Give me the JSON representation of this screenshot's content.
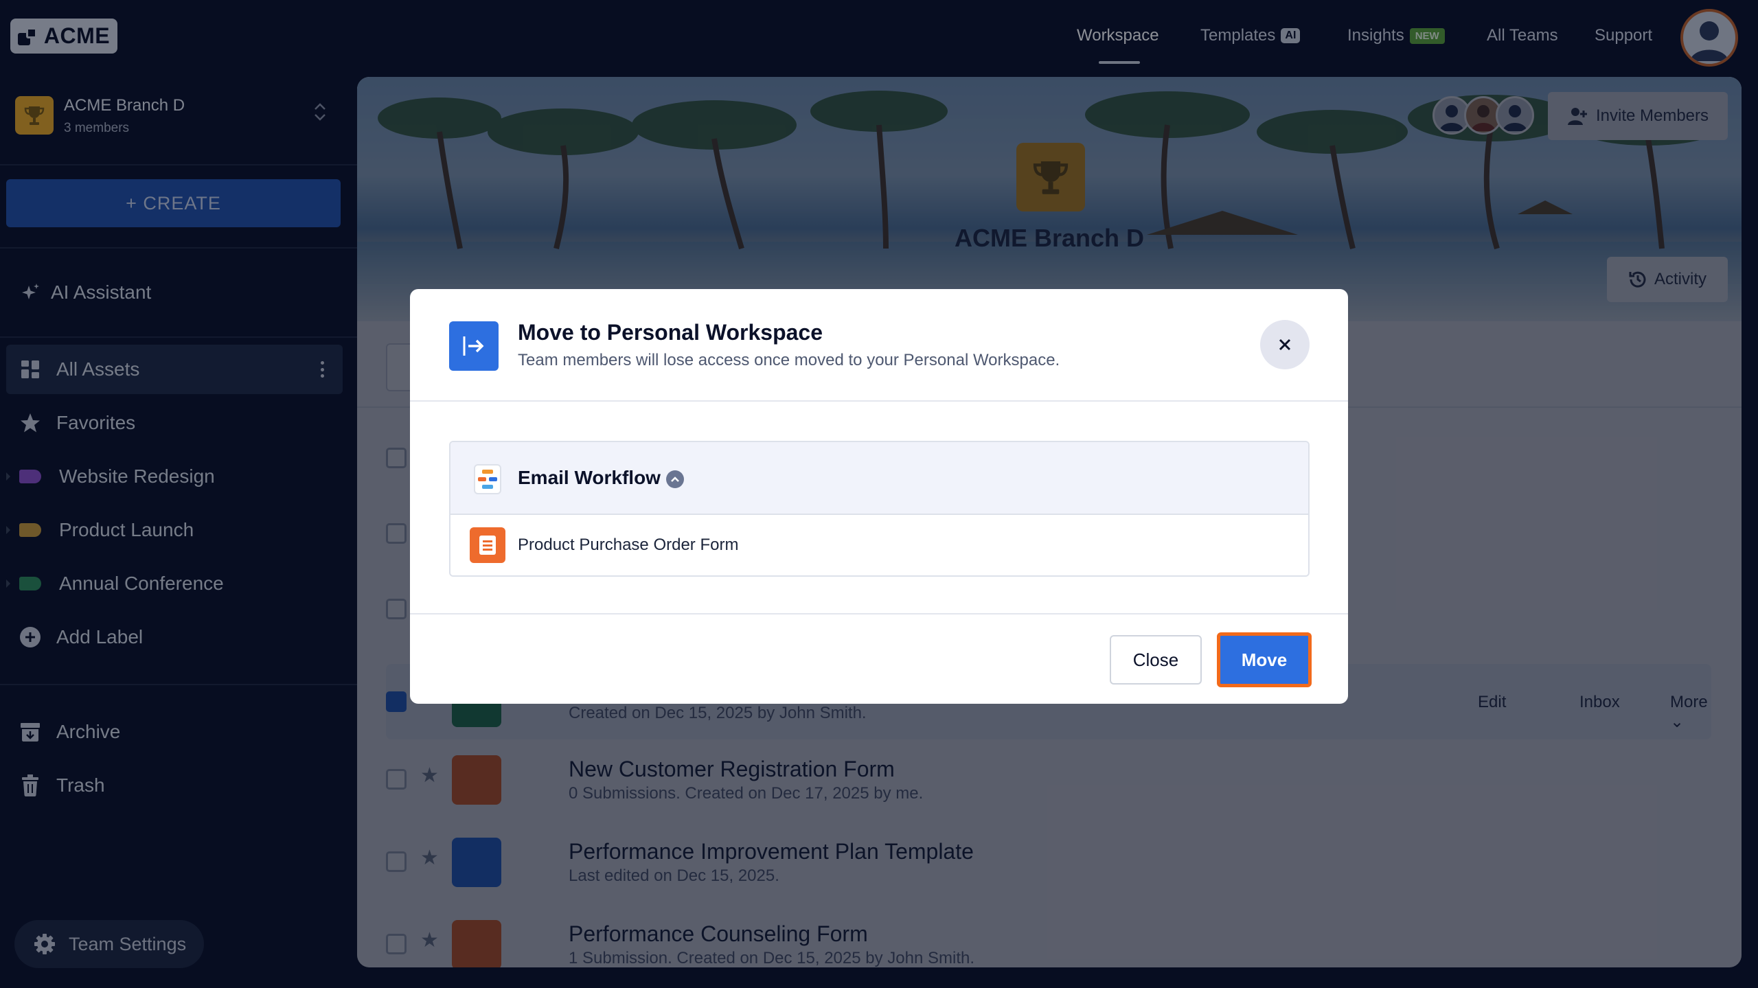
{
  "brand": {
    "logo_text": "ACME"
  },
  "nav": {
    "workspace": "Workspace",
    "templates": "Templates",
    "templates_badge": "AI",
    "insights": "Insights",
    "insights_badge": "NEW",
    "all_teams": "All Teams",
    "support": "Support"
  },
  "team": {
    "name": "ACME Branch D",
    "members": "3 members"
  },
  "sidebar": {
    "create_label": "+ CREATE",
    "ai_assistant": "AI Assistant",
    "all_assets": "All Assets",
    "favorites": "Favorites",
    "labels": [
      {
        "name": "Website Redesign",
        "color": "#8a4fc9"
      },
      {
        "name": "Product Launch",
        "color": "#c99a3a"
      },
      {
        "name": "Annual Conference",
        "color": "#2f8a5a"
      }
    ],
    "add_label": "Add Label",
    "archive": "Archive",
    "trash": "Trash",
    "team_settings": "Team Settings"
  },
  "banner": {
    "title": "ACME Branch D",
    "invite_label": "Invite Members",
    "activity_label": "Activity"
  },
  "assets": {
    "selected_row_sub": "Created on Dec 15, 2025 by John Smith.",
    "row_actions": {
      "edit": "Edit",
      "inbox": "Inbox",
      "more": "More"
    },
    "rows": [
      {
        "title": "New Customer Registration Form",
        "sub": "0 Submissions. Created on Dec 17, 2025 by me.",
        "icon_color": "#ee6b2d"
      },
      {
        "title": "Performance Improvement Plan Template",
        "sub": "Last edited on Dec 15, 2025.",
        "icon_color": "#2d6fe0"
      },
      {
        "title": "Performance Counseling Form",
        "sub": "1 Submission. Created on Dec 15, 2025 by John Smith.",
        "icon_color": "#ee6b2d"
      }
    ]
  },
  "modal": {
    "title": "Move to Personal Workspace",
    "description": "Team members will lose access once moved to your Personal Workspace.",
    "folder_name": "Email Workflow",
    "item_name": "Product Purchase Order Form",
    "close_label": "Close",
    "move_label": "Move"
  },
  "colors": {
    "background": "#0b1129",
    "primary": "#2d6fe0",
    "highlight": "#f26a1b",
    "trophy": "#e9a825"
  }
}
